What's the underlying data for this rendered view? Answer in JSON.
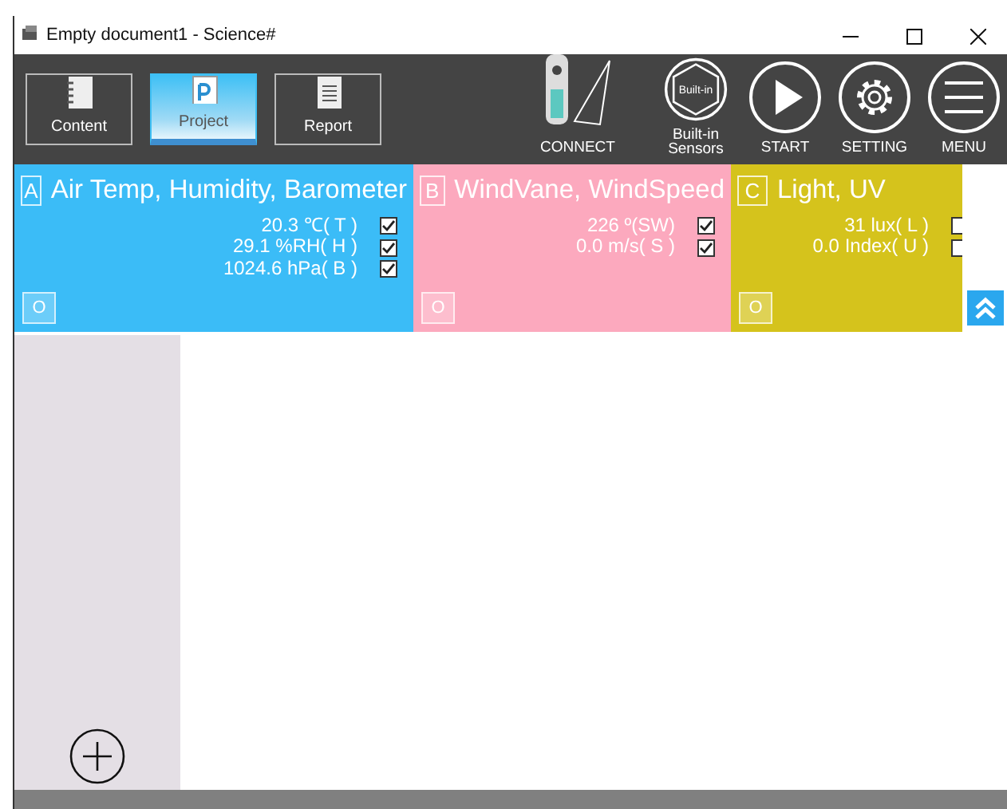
{
  "window": {
    "title": "Empty document1 - Science#"
  },
  "tabs": [
    {
      "label": "Content",
      "kind": "content",
      "selected": false
    },
    {
      "label": "Project",
      "kind": "project",
      "selected": true
    },
    {
      "label": "Report",
      "kind": "report",
      "selected": false
    }
  ],
  "tools": [
    {
      "label": "CONNECT",
      "kind": "device"
    },
    {
      "label": "Built-in Sensors",
      "kind": "builtin",
      "icon_text": "Built-in"
    },
    {
      "label": "START",
      "kind": "play"
    },
    {
      "label": "SETTING",
      "kind": "gear"
    },
    {
      "label": "MENU",
      "kind": "menu"
    }
  ],
  "sensors": [
    {
      "letter": "A",
      "title": "Air Temp, Humidity, Barometer",
      "color": "#3bbcf7",
      "button": "O",
      "readings": [
        {
          "text": "20.3 ℃( T )",
          "checked": true
        },
        {
          "text": "29.1 %RH( H )",
          "checked": true
        },
        {
          "text": "1024.6 hPa( B )",
          "checked": true
        }
      ]
    },
    {
      "letter": "B",
      "title": "WindVane, WindSpeed",
      "color": "#fca9be",
      "button": "O",
      "readings": [
        {
          "text": "226 º(SW)",
          "checked": true
        },
        {
          "text": "0.0 m/s( S )",
          "checked": true
        }
      ]
    },
    {
      "letter": "C",
      "title": "Light, UV",
      "color": "#d5c31c",
      "button": "O",
      "readings": [
        {
          "text": "31 lux( L )"
        },
        {
          "text": "0.0 Index( U )"
        }
      ]
    }
  ]
}
